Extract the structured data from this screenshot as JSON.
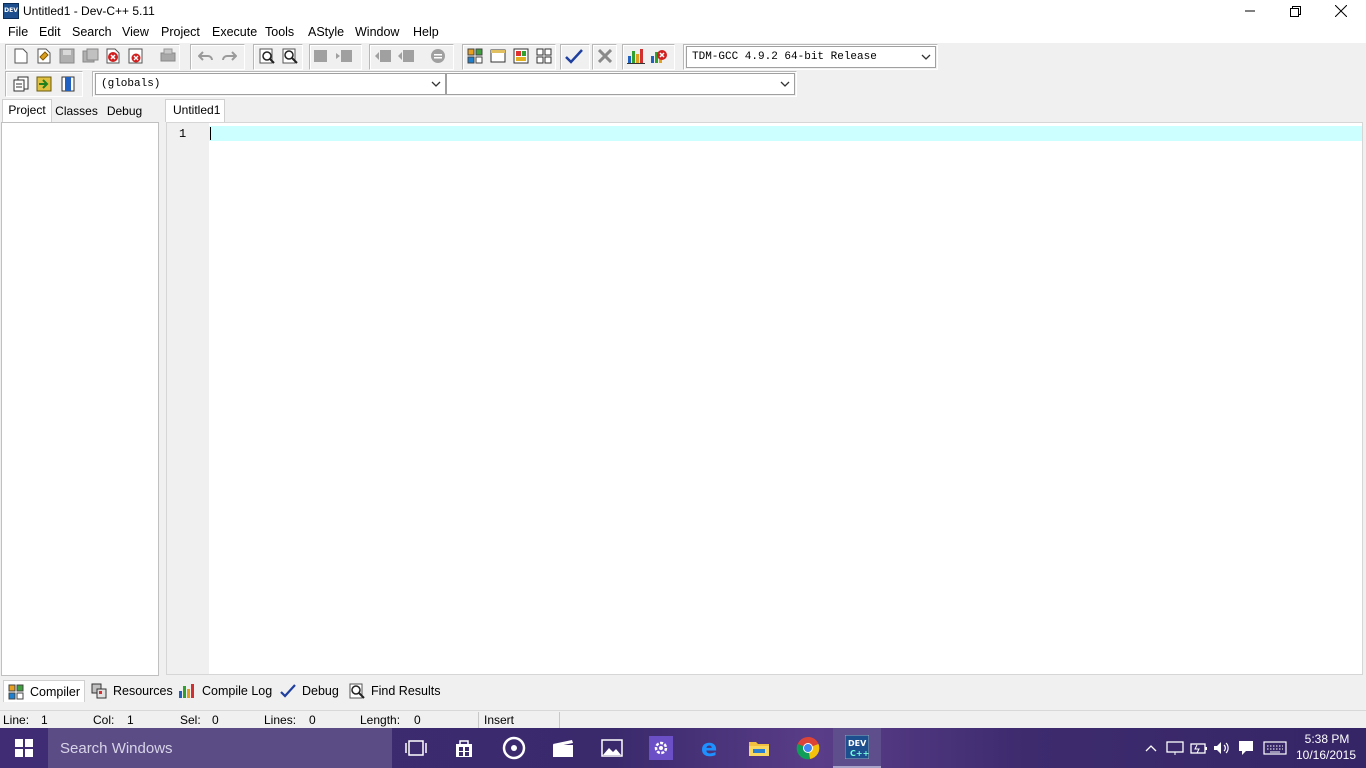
{
  "window": {
    "title": "Untitled1 - Dev-C++ 5.11",
    "app_icon_text": "DEV"
  },
  "menu": [
    "File",
    "Edit",
    "Search",
    "View",
    "Project",
    "Execute",
    "Tools",
    "AStyle",
    "Window",
    "Help"
  ],
  "toolbar": {
    "compiler_select": "TDM-GCC 4.9.2 64-bit Release",
    "scope_select": "(globals)",
    "member_select": ""
  },
  "left_panel": {
    "tabs": [
      "Project",
      "Classes",
      "Debug"
    ],
    "active_tab": "Project"
  },
  "editor": {
    "tab_label": "Untitled1",
    "line_numbers": [
      "1"
    ],
    "current_line_color": "#ccffff"
  },
  "bottom_tabs": [
    "Compiler",
    "Resources",
    "Compile Log",
    "Debug",
    "Find Results"
  ],
  "status": {
    "line_label": "Line:",
    "line_value": "1",
    "col_label": "Col:",
    "col_value": "1",
    "sel_label": "Sel:",
    "sel_value": "0",
    "lines_label": "Lines:",
    "lines_value": "0",
    "length_label": "Length:",
    "length_value": "0",
    "mode": "Insert"
  },
  "taskbar": {
    "search_placeholder": "Search Windows",
    "clock_time": "5:38 PM",
    "clock_date": "10/16/2015",
    "apps": [
      "task-view-icon",
      "store-icon",
      "groove-icon",
      "movies-icon",
      "photos-icon",
      "settings-icon",
      "edge-icon",
      "file-explorer-icon",
      "chrome-icon",
      "devcpp-icon"
    ]
  },
  "colors": {
    "taskbar": "#3b2a6b",
    "accent": "#1d4f8f"
  }
}
